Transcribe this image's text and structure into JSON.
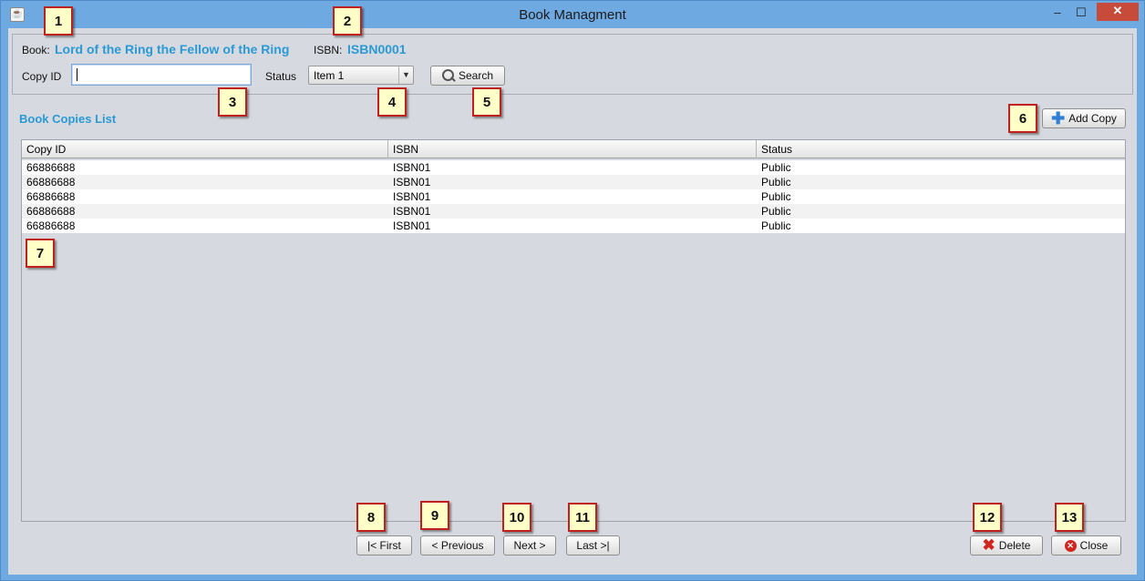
{
  "window": {
    "title": "Book Managment",
    "minimize": "–",
    "maximize": "☐",
    "close": "✕"
  },
  "search": {
    "book_label": "Book:",
    "book_title": "Lord of the Ring the Fellow of the Ring",
    "isbn_label": "ISBN:",
    "isbn_value": "ISBN0001",
    "copy_id_label": "Copy ID",
    "copy_id_value": "",
    "status_label": "Status",
    "status_selected": "Item 1",
    "search_button": "Search"
  },
  "list": {
    "title": "Book Copies List",
    "add_copy_button": "Add Copy",
    "columns": [
      "Copy ID",
      "ISBN",
      "Status"
    ],
    "rows": [
      [
        "66886688",
        "ISBN01",
        "Public"
      ],
      [
        "66886688",
        "ISBN01",
        "Public"
      ],
      [
        "66886688",
        "ISBN01",
        "Public"
      ],
      [
        "66886688",
        "ISBN01",
        "Public"
      ],
      [
        "66886688",
        "ISBN01",
        "Public"
      ]
    ]
  },
  "pagination": {
    "first": "|< First",
    "previous": "< Previous",
    "next": "Next >",
    "last": "Last >|"
  },
  "actions": {
    "delete": "Delete",
    "close": "Close"
  },
  "callouts": [
    "1",
    "2",
    "3",
    "4",
    "5",
    "6",
    "7",
    "8",
    "9",
    "10",
    "11",
    "12",
    "13"
  ],
  "colors": {
    "accent_text": "#2b9ad4",
    "window_frame": "#6fa9e2",
    "panel_bg": "#d6d9df",
    "callout_border": "#c0211e",
    "callout_fill": "#ffffc8"
  },
  "icons": {
    "search": "magnifier-icon",
    "add": "plus-icon",
    "delete": "red-x-icon",
    "close": "close-circle-icon",
    "app": "java-app-icon"
  }
}
